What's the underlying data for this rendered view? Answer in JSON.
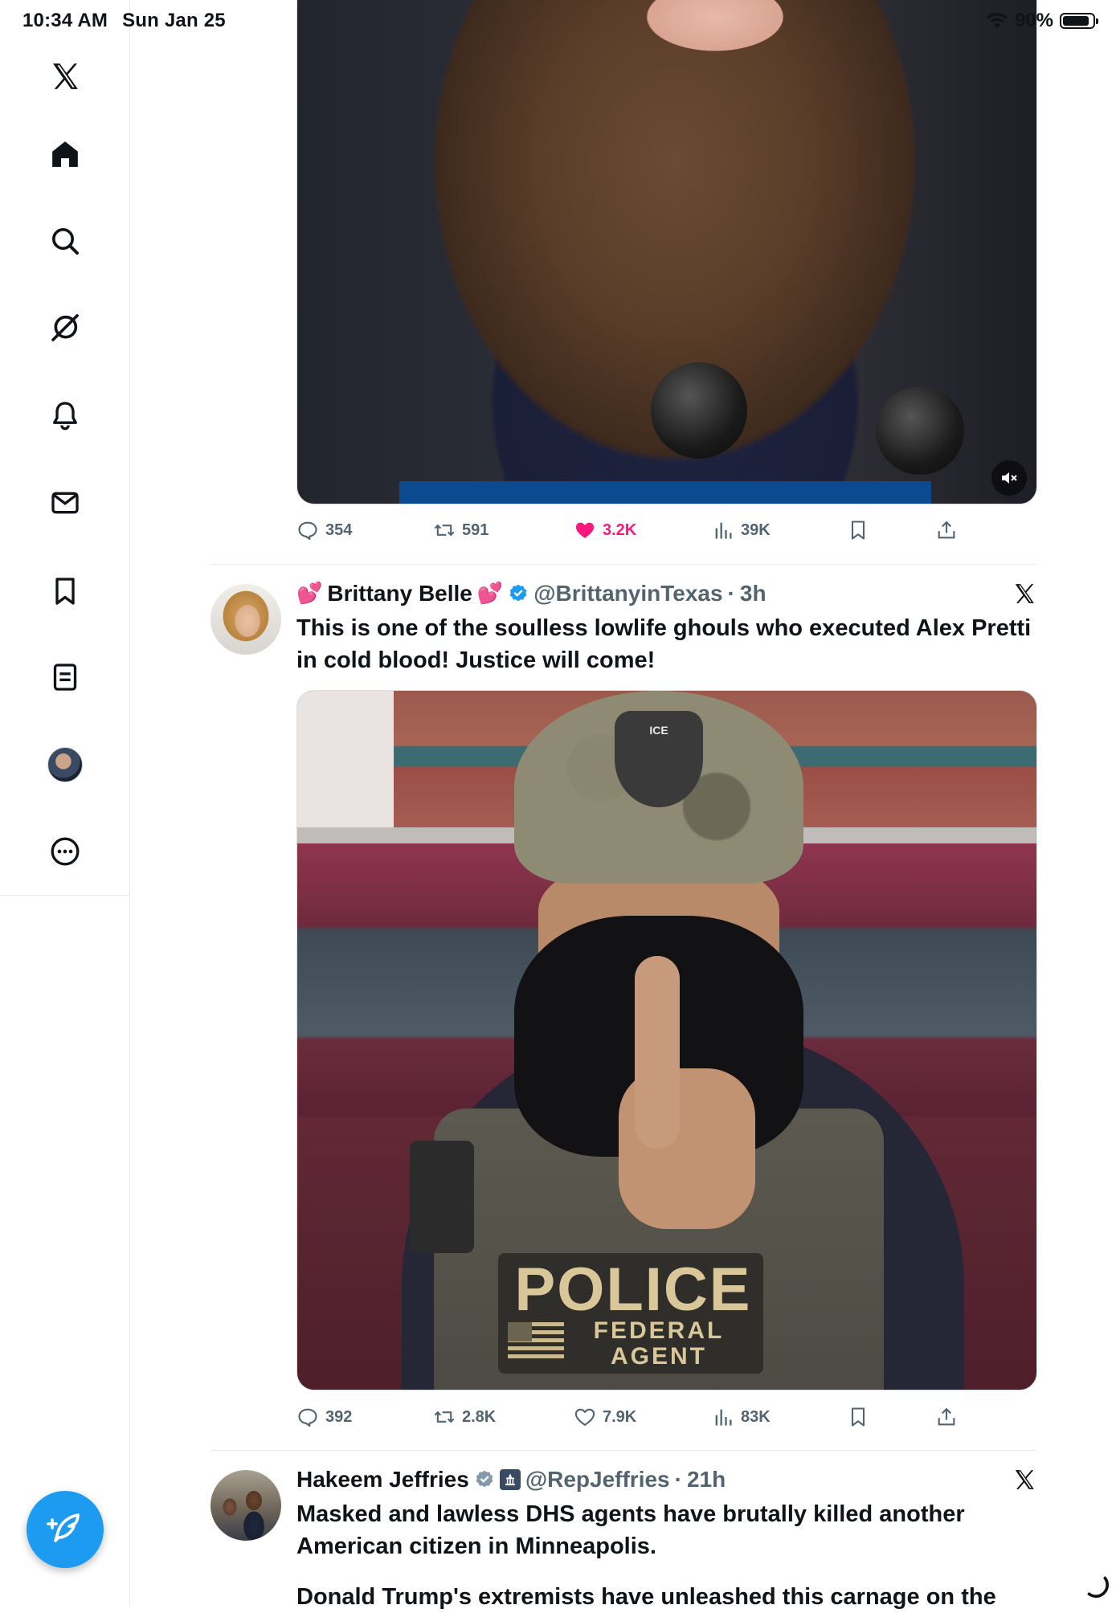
{
  "status_bar": {
    "time": "10:34 AM",
    "date": "Sun Jan 25",
    "battery_percent": "90%",
    "battery_level": 0.9
  },
  "sidebar": {
    "items": [
      {
        "name": "x-logo-icon",
        "label": "X"
      },
      {
        "name": "home-icon",
        "label": "Home"
      },
      {
        "name": "search-icon",
        "label": "Explore"
      },
      {
        "name": "grok-icon",
        "label": "Grok"
      },
      {
        "name": "bell-icon",
        "label": "Notifications"
      },
      {
        "name": "mail-icon",
        "label": "Messages"
      },
      {
        "name": "bookmark-icon",
        "label": "Bookmarks"
      },
      {
        "name": "lists-icon",
        "label": "Lists"
      },
      {
        "name": "avatar",
        "label": "Profile"
      },
      {
        "name": "more-icon",
        "label": "More"
      }
    ],
    "compose_icon": "compose-feather-icon"
  },
  "feed": {
    "tweets": [
      {
        "media_type": "video",
        "actions": {
          "replies": "354",
          "reposts": "591",
          "likes": "3.2K",
          "liked": true,
          "views": "39K"
        }
      },
      {
        "display_name": "Brittany Belle",
        "name_emoji": "💕",
        "verified": true,
        "handle": "@BrittanyinTexas",
        "separator": "·",
        "time": "3h",
        "text": "This is one of the soulless lowlife ghouls who executed Alex Pretti in cold blood! Justice will come!",
        "media_type": "image",
        "image_text": {
          "cap": "ICE",
          "patch_main": "POLICE",
          "patch_line1": "FEDERAL",
          "patch_line2": "AGENT"
        },
        "actions": {
          "replies": "392",
          "reposts": "2.8K",
          "likes": "7.9K",
          "liked": false,
          "views": "83K"
        }
      },
      {
        "display_name": "Hakeem Jeffries",
        "verified": true,
        "gov_badge": true,
        "handle": "@RepJeffries",
        "separator": "·",
        "time": "21h",
        "text": "Masked and lawless DHS agents have brutally killed another American citizen in Minneapolis.",
        "text_cut": "Donald Trump's extremists have unleashed this carnage on the"
      }
    ]
  },
  "colors": {
    "accent": "#1d9bf0",
    "like": "#f91880",
    "muted_text": "#536471",
    "text": "#0f1419"
  }
}
